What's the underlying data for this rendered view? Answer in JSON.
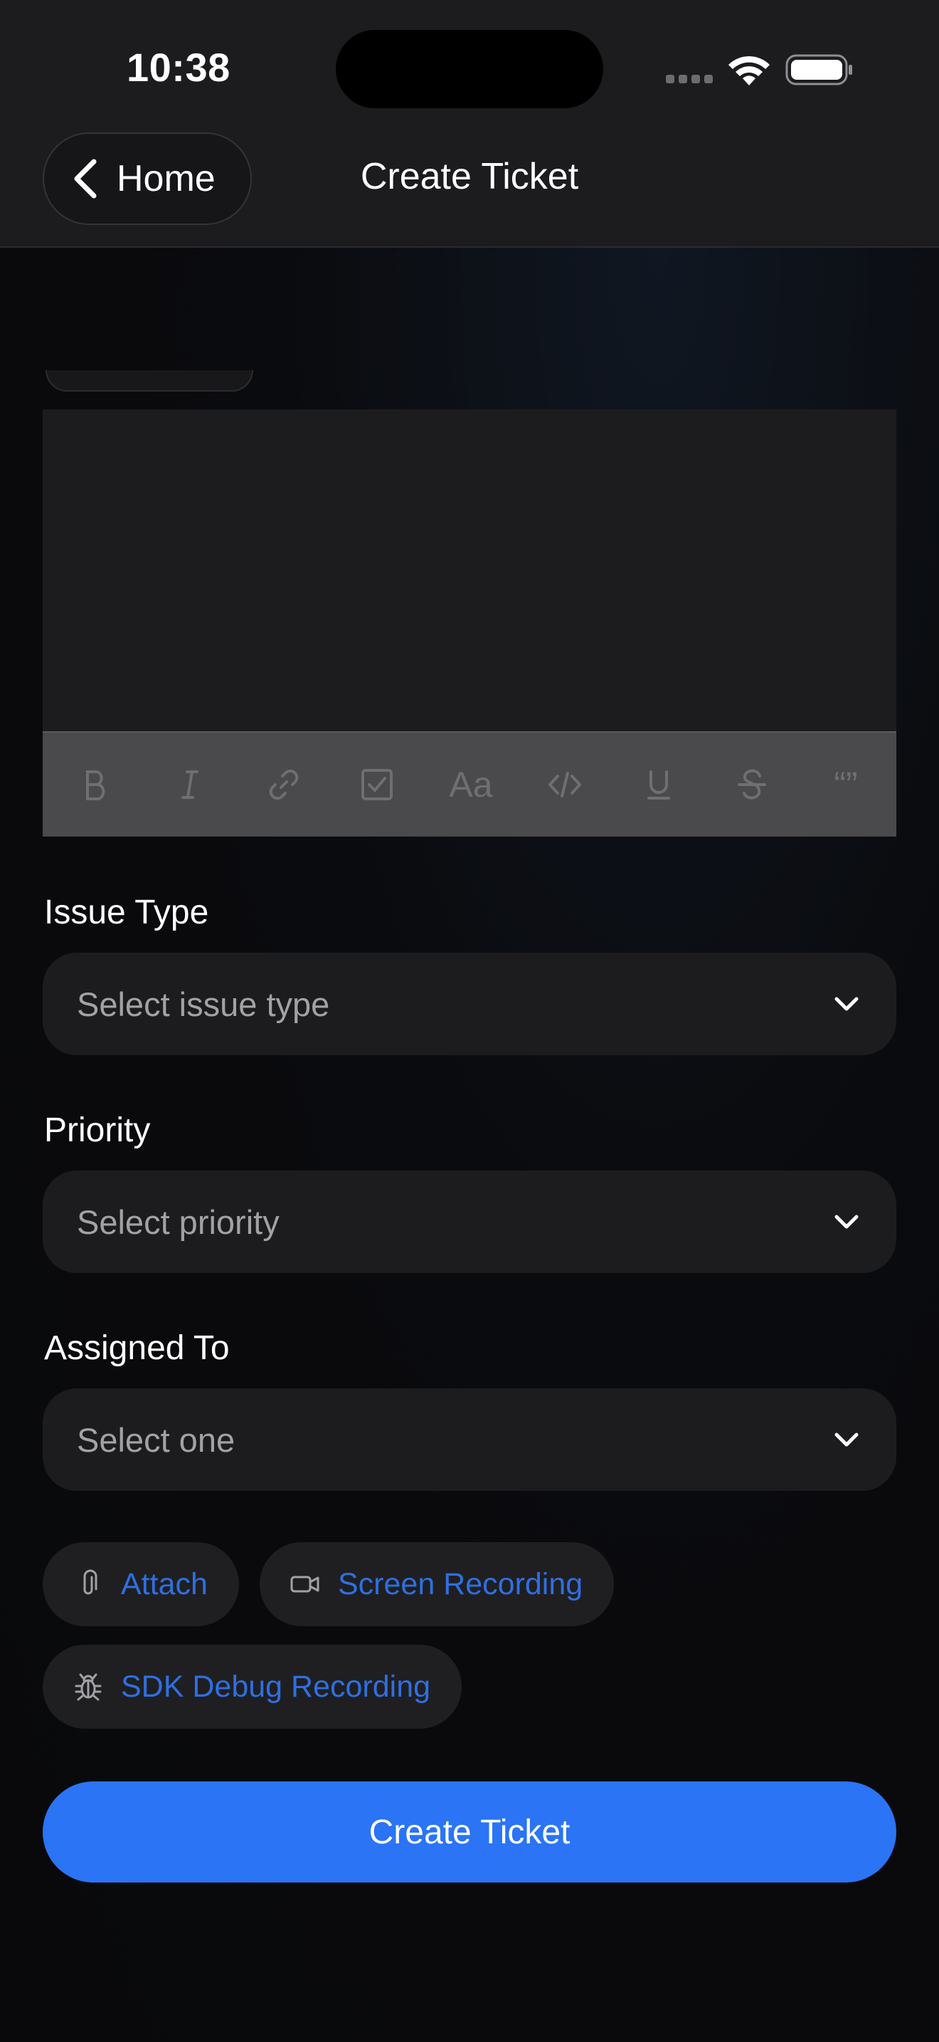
{
  "status_bar": {
    "time": "10:38"
  },
  "nav": {
    "back_label": "Home",
    "title": "Create Ticket"
  },
  "editor": {
    "toolbar": [
      "bold-icon",
      "italic-icon",
      "link-icon",
      "checkbox-icon",
      "text-size-icon",
      "code-icon",
      "underline-icon",
      "strikethrough-icon",
      "quote-icon"
    ],
    "text_size_glyph": "Aa",
    "quote_glyph": "“”"
  },
  "form": {
    "issue_type": {
      "label": "Issue Type",
      "placeholder": "Select issue type"
    },
    "priority": {
      "label": "Priority",
      "placeholder": "Select priority"
    },
    "assigned_to": {
      "label": "Assigned To",
      "placeholder": "Select one"
    }
  },
  "attachments": {
    "attach_label": "Attach",
    "screen_recording_label": "Screen Recording",
    "sdk_debug_label": "SDK Debug Recording"
  },
  "submit": {
    "label": "Create Ticket"
  },
  "colors": {
    "accent": "#2a74f5",
    "link": "#2f6fe0",
    "surface": "#1c1c1e",
    "background": "#0a0a0c"
  }
}
